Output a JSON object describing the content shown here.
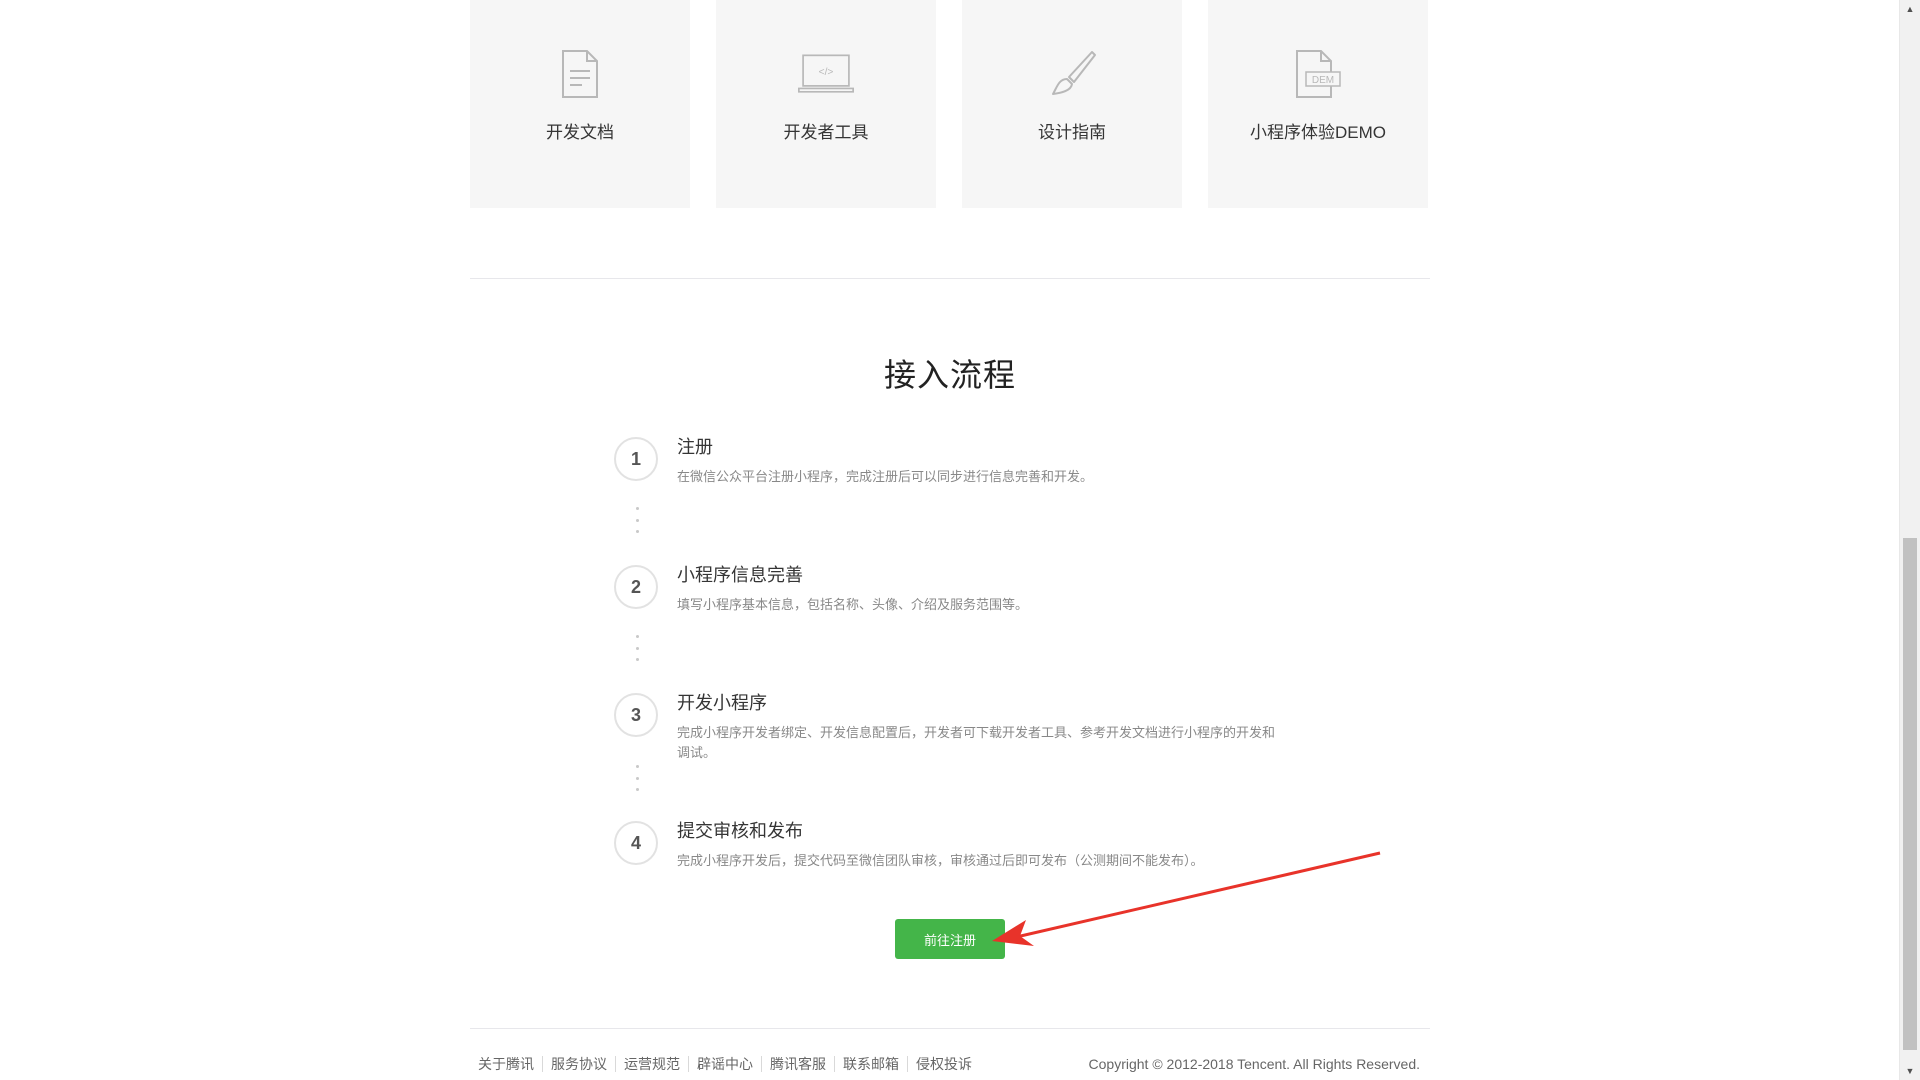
{
  "cards": [
    {
      "label": "开发文档",
      "icon": "document-icon"
    },
    {
      "label": "开发者工具",
      "icon": "laptop-code-icon"
    },
    {
      "label": "设计指南",
      "icon": "paintbrush-icon"
    },
    {
      "label": "小程序体验DEMO",
      "icon": "demo-file-icon",
      "icon_text": "DEM"
    }
  ],
  "laptop_icon_text": "</>",
  "section_title": "接入流程",
  "steps": [
    {
      "number": "1",
      "title": "注册",
      "desc": "在微信公众平台注册小程序，完成注册后可以同步进行信息完善和开发。"
    },
    {
      "number": "2",
      "title": "小程序信息完善",
      "desc": "填写小程序基本信息，包括名称、头像、介绍及服务范围等。"
    },
    {
      "number": "3",
      "title": "开发小程序",
      "desc": "完成小程序开发者绑定、开发信息配置后，开发者可下载开发者工具、参考开发文档进行小程序的开发和调试。"
    },
    {
      "number": "4",
      "title": "提交审核和发布",
      "desc": "完成小程序开发后，提交代码至微信团队审核，审核通过后即可发布（公测期间不能发布）。"
    }
  ],
  "register_button": "前往注册",
  "footer": {
    "links": [
      "关于腾讯",
      "服务协议",
      "运营规范",
      "辟谣中心",
      "腾讯客服",
      "联系邮箱",
      "侵权投诉"
    ],
    "copyright": "Copyright © 2012-2018 Tencent. All Rights Reserved."
  },
  "colors": {
    "button_green": "#44b549",
    "annotation_arrow": "#e8332a",
    "card_bg": "#f6f6f6"
  }
}
